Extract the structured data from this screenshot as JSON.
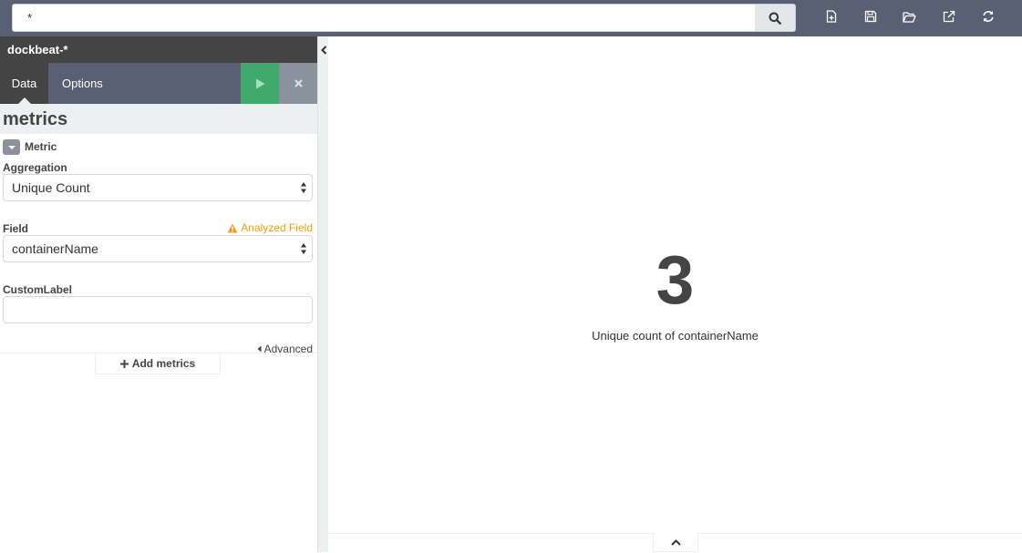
{
  "query_bar": {
    "value": "*"
  },
  "toolbar": {
    "icons": [
      "new-visualization-icon",
      "save-icon",
      "open-icon",
      "share-icon",
      "refresh-icon"
    ]
  },
  "sidebar": {
    "index_pattern": "dockbeat-*",
    "tabs": [
      {
        "label": "Data",
        "active": true
      },
      {
        "label": "Options",
        "active": false
      }
    ],
    "section_title": "metrics",
    "metric": {
      "label": "Metric",
      "aggregation_label": "Aggregation",
      "aggregation_value": "Unique Count",
      "field_label": "Field",
      "field_warning": "Analyzed Field",
      "field_value": "containerName",
      "custom_label_label": "CustomLabel",
      "custom_label_value": "",
      "advanced_label": "Advanced"
    },
    "add_metrics_label": "Add metrics"
  },
  "visualization": {
    "value": "3",
    "description": "Unique count of containerName"
  },
  "colors": {
    "topbar": "#5a6073",
    "apply": "#41a96b",
    "warning": "#f39c12"
  }
}
